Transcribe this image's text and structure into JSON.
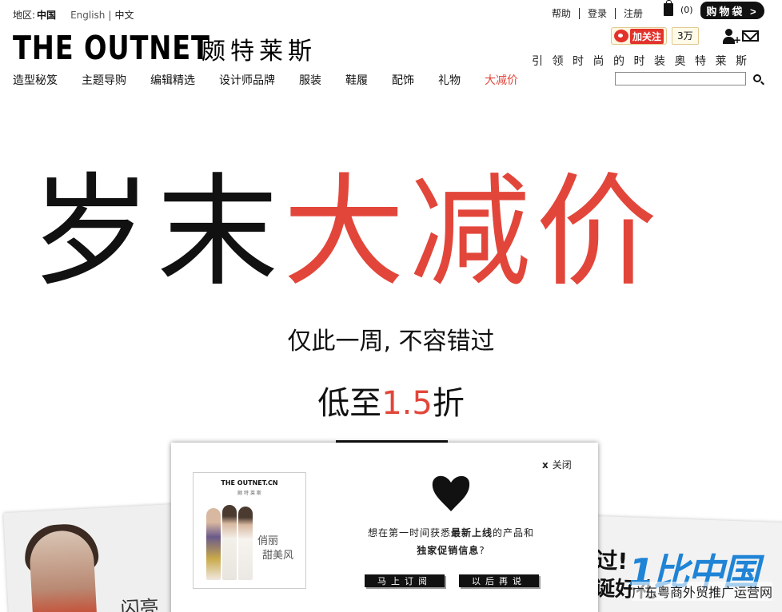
{
  "header": {
    "region_label": "地区:",
    "region_value": "中国",
    "lang_en": "English",
    "lang_sep": "|",
    "lang_zh": "中文",
    "logo_en": "THE OUTNET",
    "logo_zh": "颇特莱斯",
    "links": [
      "帮助",
      "登录",
      "注册"
    ],
    "bag_count": "(0)",
    "bag_label": "购物袋 >",
    "weibo_label": "加关注",
    "weibo_count": "3万",
    "tagline": "引领时尚的时装奥特莱斯",
    "search_placeholder": ""
  },
  "nav": {
    "items": [
      "造型秘笈",
      "主题导购",
      "编辑精选",
      "设计师品牌",
      "服装",
      "鞋履",
      "配饰",
      "礼物",
      "大减价"
    ]
  },
  "hero": {
    "title_black": "岁末",
    "title_red": "大减价",
    "subtitle": "仅此一周, 不容错过",
    "discount_prefix": "低至",
    "discount_value": "1.5",
    "discount_suffix": "折"
  },
  "photos": {
    "left_caption": "闪亮",
    "right_text1": "过!",
    "right_text2": "诞好礼",
    "watermark_logo": "1比中国",
    "watermark_text": "广东粤商外贸推广运营网"
  },
  "popup": {
    "close_label": "关闭",
    "promo_brand": "THE OUTNET.CN",
    "promo_brand_sub": "颇 特 莱 斯",
    "promo_headline": "俏丽",
    "promo_headline2": "甜美风",
    "msg_part1": "想在第一时间获悉",
    "msg_bold1": "最新上线",
    "msg_part2": "的产品和",
    "msg_bold2": "独家促销信息",
    "msg_part3": "?",
    "subscribe_label": "马上订阅",
    "later_label": "以后再说"
  },
  "colors": {
    "accent_red": "#e2463a",
    "weibo_red": "#e2322b",
    "text": "#111111"
  }
}
